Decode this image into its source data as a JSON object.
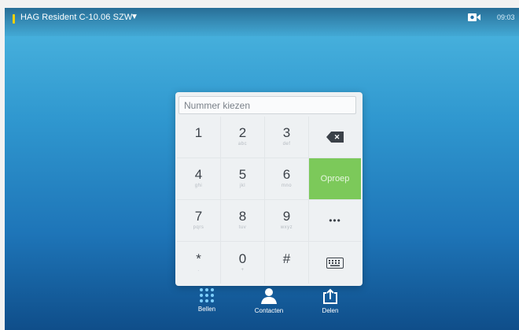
{
  "topbar": {
    "device_name": "HAG Resident C-10.06 SZW",
    "caret": "▼",
    "camera_icon": "video-camera-icon",
    "time": "09:03",
    "status_color": "#f5d000"
  },
  "dialpad": {
    "placeholder": "Nummer kiezen",
    "keys": [
      {
        "digit": "1",
        "sub": ""
      },
      {
        "digit": "2",
        "sub": "abc"
      },
      {
        "digit": "3",
        "sub": "def"
      },
      {
        "digit": "4",
        "sub": "ghi"
      },
      {
        "digit": "5",
        "sub": "jkl"
      },
      {
        "digit": "6",
        "sub": "mno"
      },
      {
        "digit": "7",
        "sub": "pqrs"
      },
      {
        "digit": "8",
        "sub": "tuv"
      },
      {
        "digit": "9",
        "sub": "wxyz"
      },
      {
        "digit": "*",
        "sub": "."
      },
      {
        "digit": "0",
        "sub": "+"
      },
      {
        "digit": "#",
        "sub": ""
      }
    ],
    "call_label": "Oproep",
    "call_color": "#7cc95a",
    "more_label": "•••",
    "backspace_glyph": "✕"
  },
  "bottombar": {
    "tabs": [
      {
        "label": "Bellen",
        "icon": "dialpad-icon"
      },
      {
        "label": "Contacten",
        "icon": "person-icon"
      },
      {
        "label": "Delen",
        "icon": "share-icon"
      }
    ]
  }
}
